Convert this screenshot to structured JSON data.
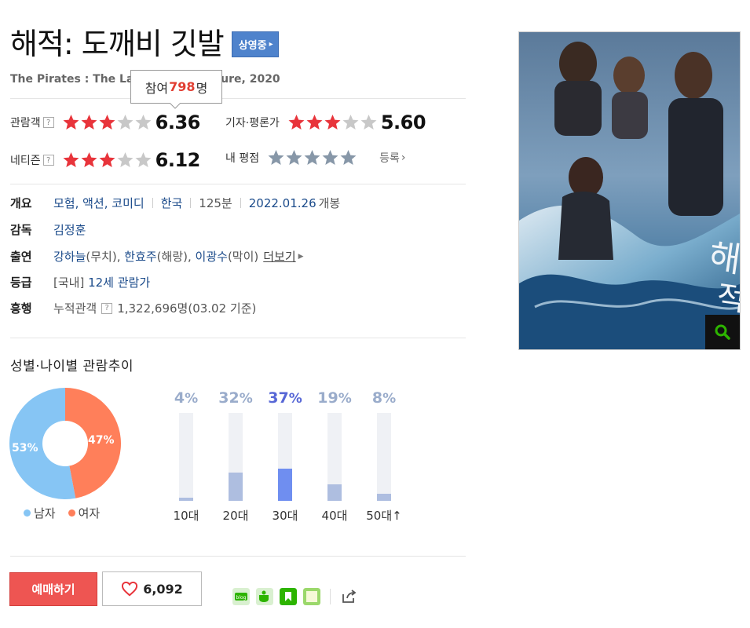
{
  "movie": {
    "title": "해적: 도깨비 깃발",
    "status_badge": "상영중",
    "subtitle": "The Pirates : The Last Royal Treasure, 2020"
  },
  "tooltip": {
    "prefix": "참여",
    "count": "798",
    "suffix": "명"
  },
  "ratings": {
    "audience": {
      "label": "관람객",
      "stars_filled": 3,
      "stars_total": 5,
      "score": "6.36"
    },
    "critic": {
      "label": "기자·평론가",
      "stars_filled": 3,
      "stars_total": 5,
      "score": "5.60"
    },
    "netizen": {
      "label": "네티즌",
      "stars_filled": 3,
      "stars_total": 5,
      "score": "6.12"
    },
    "mine": {
      "label": "내 평점",
      "stars_filled": 0,
      "stars_total": 5,
      "action": "등록"
    }
  },
  "info": {
    "overview": {
      "label": "개요",
      "genres": "모험, 액션, 코미디",
      "country": "한국",
      "runtime": "125분",
      "release_date": "2022.01.26",
      "release_suffix": "개봉"
    },
    "director": {
      "label": "감독",
      "name": "김정훈"
    },
    "cast": {
      "label": "출연",
      "members": [
        {
          "name": "강하늘",
          "role": "(무치)"
        },
        {
          "name": "한효주",
          "role": "(해랑)"
        },
        {
          "name": "이광수",
          "role": "(막이)"
        }
      ],
      "more": "더보기"
    },
    "rating": {
      "label": "등급",
      "prefix": "[국내]",
      "value": "12세 관람가"
    },
    "boxoffice": {
      "label": "흥행",
      "prefix": "누적관객",
      "value": "1,322,696명(03.02 기준)"
    }
  },
  "audience_trend": {
    "title": "성별·나이별 관람추이",
    "gender": [
      {
        "label": "남자",
        "percent": 53,
        "color": "#86c5f4"
      },
      {
        "label": "여자",
        "percent": 47,
        "color": "#ff7f5a"
      }
    ],
    "ages": [
      {
        "label": "10대",
        "percent": 4,
        "highlight": false
      },
      {
        "label": "20대",
        "percent": 32,
        "highlight": false
      },
      {
        "label": "30대",
        "percent": 37,
        "highlight": true
      },
      {
        "label": "40대",
        "percent": 19,
        "highlight": false
      },
      {
        "label": "50대",
        "percent": 8,
        "highlight": false,
        "suffix": "↑"
      }
    ]
  },
  "actions": {
    "book_label": "예매하기",
    "like_count": "6,092"
  },
  "colors": {
    "star_on": "#e8343b",
    "star_off": "#c8c8c8",
    "star_mine": "#8797a8",
    "link": "#1a4a8a",
    "badge": "#4f83cc"
  }
}
